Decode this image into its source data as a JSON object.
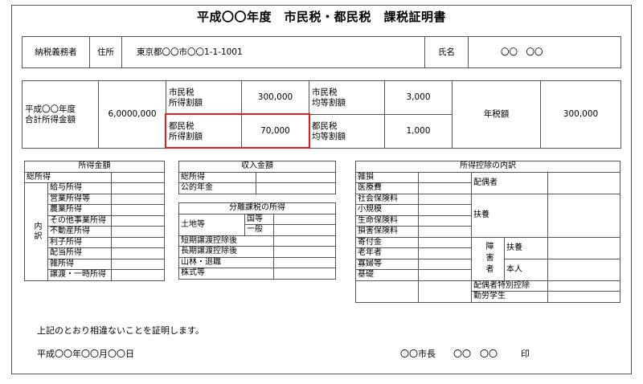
{
  "title": "平成〇〇年度　市民税・都民税　課税証明書",
  "taxpayer": {
    "label": "納税義務者",
    "address_label": "住所",
    "address": "東京都〇〇市〇〇1-1-1001",
    "name_label": "氏名",
    "name": "〇〇　〇〇"
  },
  "summary": {
    "total_income_label": "平成〇〇年度\n合計所得金額",
    "total_income": "6,0000,000",
    "city_income_label": "市民税\n所得割額",
    "city_income": "300,000",
    "city_equal_label": "市民税\n均等割額",
    "city_equal": "3,000",
    "tokyo_income_label": "都民税\n所得割額",
    "tokyo_income": "70,000",
    "tokyo_equal_label": "都民税\n均等割額",
    "tokyo_equal": "1,000",
    "annual_label": "年税額",
    "annual": "300,000"
  },
  "income_table": {
    "title": "所得金額",
    "total": "総所得",
    "breakdown_label": "内訳",
    "items": [
      "給与所得",
      "営業所得等",
      "農業所得",
      "その他事業所得",
      "不動産所得",
      "利子所得",
      "配当所得",
      "雑所得",
      "譲渡・一時所得"
    ]
  },
  "revenue_table": {
    "title": "収入金額",
    "items": [
      "総所得",
      "公的年金"
    ]
  },
  "separate_table": {
    "title": "分離課税の所得",
    "land": "土地等",
    "national": "国等",
    "general": "一般",
    "items": [
      "短期譲渡控除後",
      "長期譲渡控除後",
      "山林・退職",
      "株式等"
    ]
  },
  "deduction_table": {
    "title": "所得控除の内訳",
    "left_items": [
      "雑損",
      "医療費",
      "社会保険料",
      "小規模",
      "生命保険料",
      "損害保険料",
      "寄付金",
      "老年者",
      "寡婦等",
      "基礎"
    ],
    "spouse": "配偶者",
    "dependents": "扶養",
    "disabled": "障害者",
    "dis_dependent": "扶養",
    "dis_self": "本人",
    "spouse_special": "配偶者特別控除",
    "working_student": "勤労学生"
  },
  "certify_text": "上記のとおり相違ないことを証明します。",
  "date": "平成〇〇年〇〇月〇〇日",
  "mayor": "〇〇市長　　〇〇　〇〇",
  "seal": "印"
}
